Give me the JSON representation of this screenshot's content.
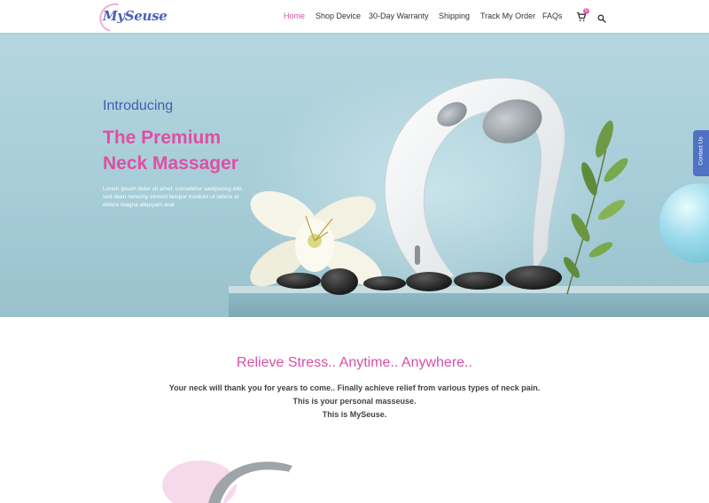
{
  "brand": {
    "logo_text": "MySeuse"
  },
  "nav": {
    "items": [
      {
        "label": "Home",
        "active": true
      },
      {
        "label": "Shop Device",
        "active": false
      },
      {
        "label": "30-Day Warranty",
        "active": false
      },
      {
        "label": "Shipping",
        "active": false
      },
      {
        "label": "Track My Order",
        "active": false
      },
      {
        "label": "FAQs",
        "active": false
      }
    ],
    "cart_count": "0"
  },
  "hero": {
    "intro": "Introducing",
    "headline_line1": "The Premium",
    "headline_line2": "Neck Massager",
    "body": "Lorem ipsum dolor sit amet, consetetur sadipscing elitr, sed diam nonumy eirmod tempor invidunt ut labore et dolore magna aliquyam erat"
  },
  "contact_tab": {
    "label": "Contact Us"
  },
  "section": {
    "title": "Relieve Stress.. Anytime.. Anywhere..",
    "line1": "Your neck will thank you for years to come.. Finally achieve relief from various types of neck pain.",
    "line2": "This is your personal masseuse.",
    "line3": "This is MySeuse."
  },
  "colors": {
    "accent_pink": "#d94fa8",
    "accent_blue": "#3f5fae",
    "hero_bg": "#a6cdd8",
    "contact_tab": "#4f72c4"
  },
  "icons": [
    "cart-icon",
    "search-icon"
  ]
}
